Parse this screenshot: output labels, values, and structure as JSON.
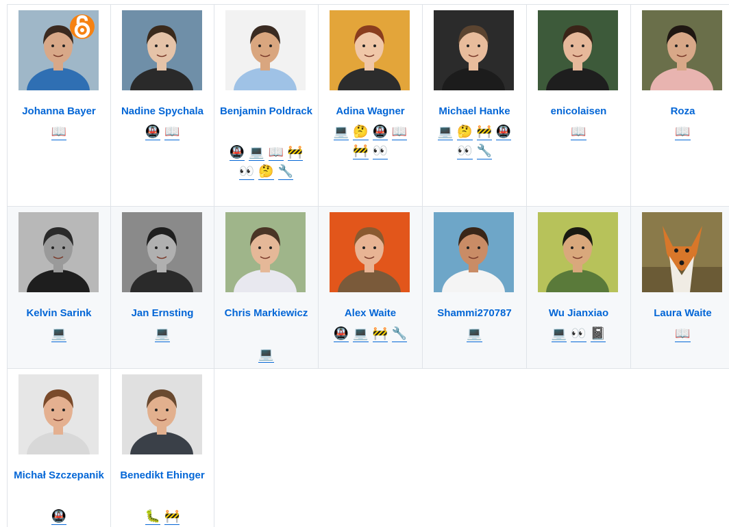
{
  "contributors": [
    {
      "name": "Johanna Bayer",
      "emojis": [
        "📖"
      ],
      "bg": "#9fb7c8",
      "skin": "#d8a888",
      "hair": "#3b2a20",
      "shirt": "#2f6fb3",
      "badge": "open-access-icon"
    },
    {
      "name": "Nadine Spychala",
      "emojis": [
        "🚇",
        "📖"
      ],
      "bg": "#6f8fa8",
      "skin": "#e5c3a8",
      "hair": "#3a2a1c",
      "shirt": "#2a2a2a"
    },
    {
      "name": "Benjamin Poldrack",
      "emojis": [
        "🚇",
        "💻",
        "📖",
        "🚧",
        "👀",
        "🤔",
        "🔧"
      ],
      "bg": "#f2f2f2",
      "skin": "#d9a67f",
      "hair": "#3a2b22",
      "shirt": "#9fc2e6"
    },
    {
      "name": "Adina Wagner",
      "emojis": [
        "💻",
        "🤔",
        "🚇",
        "📖",
        "🚧",
        "👀"
      ],
      "bg": "#e3a53a",
      "skin": "#f0c7a8",
      "hair": "#8a3d1e",
      "shirt": "#2c2c2c"
    },
    {
      "name": "Michael Hanke",
      "emojis": [
        "💻",
        "🤔",
        "🚧",
        "🚇",
        "👀",
        "🔧"
      ],
      "bg": "#2b2b2b",
      "skin": "#e8bc9c",
      "hair": "#5b4430",
      "shirt": "#1c1c1c"
    },
    {
      "name": "enicolaisen",
      "emojis": [
        "📖"
      ],
      "bg": "#3d5a3a",
      "skin": "#e6b89a",
      "hair": "#3a2418",
      "shirt": "#1e1e1e"
    },
    {
      "name": "Roza",
      "emojis": [
        "📖"
      ],
      "bg": "#6a6f4a",
      "skin": "#d8a888",
      "hair": "#1f1712",
      "shirt": "#e8b4b0"
    },
    {
      "name": "Kelvin Sarink",
      "emojis": [
        "💻"
      ],
      "bg": "#b8b8b8",
      "skin": "#9a9a9a",
      "hair": "#2a2a2a",
      "shirt": "#1e1e1e"
    },
    {
      "name": "Jan Ernsting",
      "emojis": [
        "💻"
      ],
      "bg": "#8a8a8a",
      "skin": "#b0b0b0",
      "hair": "#1e1e1e",
      "shirt": "#2a2a2a"
    },
    {
      "name": "Chris Markiewicz",
      "emojis": [
        "💻"
      ],
      "bg": "#9fb58a",
      "skin": "#e5b898",
      "hair": "#4a3526",
      "shirt": "#e8e8ef"
    },
    {
      "name": "Alex Waite",
      "emojis": [
        "🚇",
        "💻",
        "🚧",
        "🔧"
      ],
      "bg": "#e2561b",
      "skin": "#e8b494",
      "hair": "#8a5a30",
      "shirt": "#7a5a3a"
    },
    {
      "name": "Shammi270787",
      "emojis": [
        "💻"
      ],
      "bg": "#6ea6c8",
      "skin": "#c98c66",
      "hair": "#3a2618",
      "shirt": "#f4f4f4"
    },
    {
      "name": "Wu Jianxiao",
      "emojis": [
        "💻",
        "👀",
        "📓"
      ],
      "bg": "#b7c25a",
      "skin": "#d9a87c",
      "hair": "#1a1a12",
      "shirt": "#5a7a3a"
    },
    {
      "name": "Laura Waite",
      "emojis": [
        "📖"
      ],
      "bg": "#8a7a4a",
      "skin": "#d8772a",
      "hair": "#b55a1e",
      "shirt": "#f0ece4",
      "fox": "true"
    },
    {
      "name": "Michał Szczepanik",
      "emojis": [
        "🚇"
      ],
      "bg": "#e6e6e6",
      "skin": "#e4b090",
      "hair": "#7a4a2a",
      "shirt": "#d8d8d8"
    },
    {
      "name": "Benedikt Ehinger",
      "emojis": [
        "🐛",
        "🚧"
      ],
      "bg": "#e0e0e0",
      "skin": "#e2b08e",
      "hair": "#6a4a30",
      "shirt": "#3a4048"
    }
  ],
  "layout_hint": [
    "row1",
    "row2",
    "row3"
  ]
}
